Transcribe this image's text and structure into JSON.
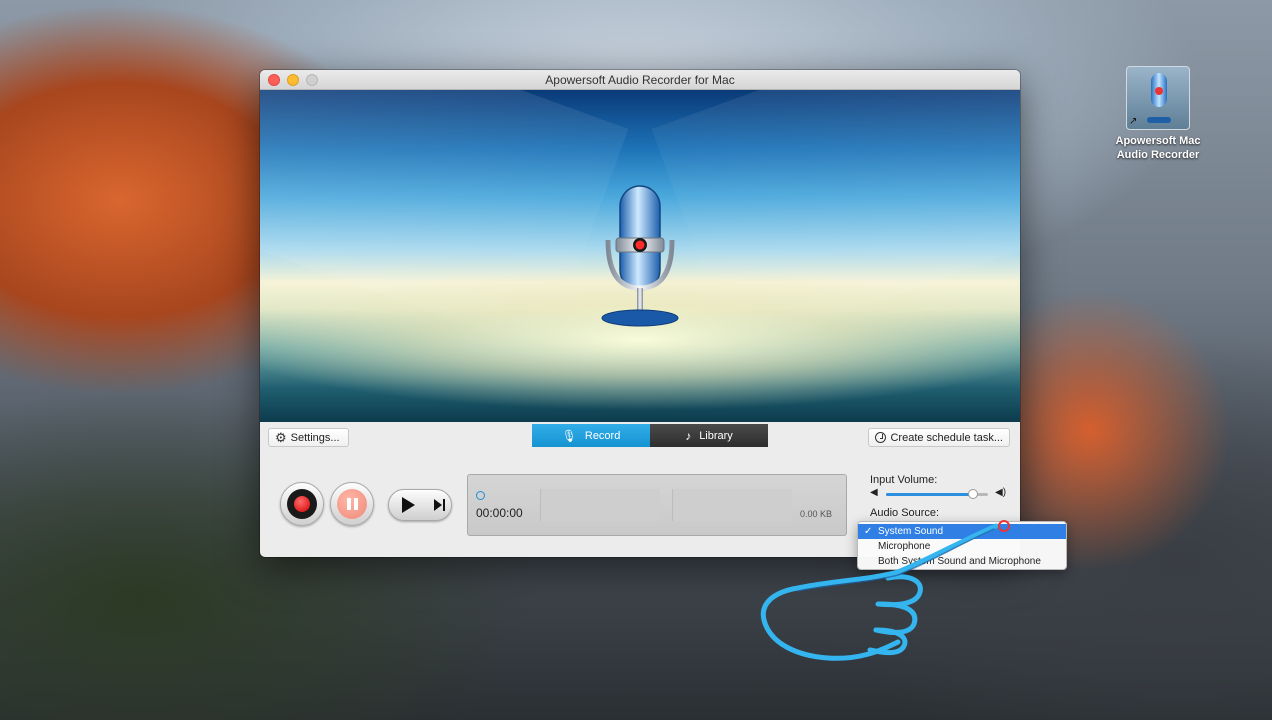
{
  "window": {
    "title": "Apowersoft Audio Recorder for Mac"
  },
  "desktop": {
    "icon_label": "Apowersoft Mac Audio Recorder"
  },
  "toolbar": {
    "settings_label": "Settings...",
    "tabs": [
      {
        "label": "Record",
        "active": true
      },
      {
        "label": "Library",
        "active": false
      }
    ],
    "schedule_label": "Create schedule task..."
  },
  "recording": {
    "elapsed": "00:00:00",
    "file_size": "0.00 KB"
  },
  "side": {
    "input_volume_label": "Input Volume:",
    "input_volume": 0.85,
    "audio_source_label": "Audio Source:"
  },
  "audio_source_menu": {
    "options": [
      {
        "label": "System Sound",
        "selected": true
      },
      {
        "label": "Microphone",
        "selected": false
      },
      {
        "label": "Both System Sound and Microphone",
        "selected": false
      }
    ]
  },
  "colors": {
    "accent": "#1a9ae0",
    "record_red": "#d40000",
    "annotation_blue": "#35b5ef"
  },
  "icons": {
    "settings": "gear-icon",
    "record_tab": "microphone-icon",
    "library_tab": "music-note-icon",
    "schedule": "clock-icon",
    "volume_low": "speaker-low-icon",
    "volume_high": "speaker-high-icon"
  }
}
